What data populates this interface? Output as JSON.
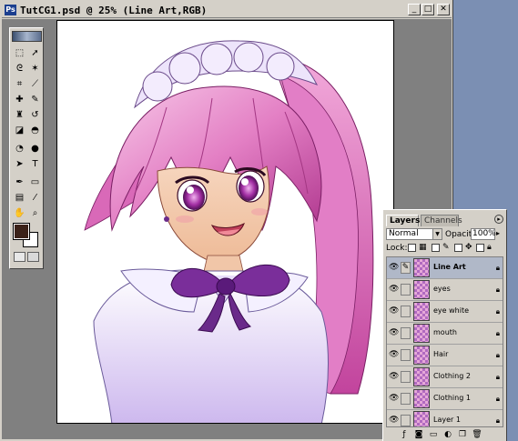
{
  "window": {
    "title": "TutCG1.psd @ 25% (Line Art,RGB)",
    "minimize_glyph": "_",
    "maximize_glyph": "□",
    "close_glyph": "✕"
  },
  "toolbox": {
    "foreground_color": "#3b2118",
    "background_color": "#ffffff",
    "tools": [
      {
        "name": "marquee-tool",
        "glyph": "⬚"
      },
      {
        "name": "move-tool",
        "glyph": "➚"
      },
      {
        "name": "lasso-tool",
        "glyph": "ᘓ"
      },
      {
        "name": "magic-wand-tool",
        "glyph": "✶"
      },
      {
        "name": "crop-tool",
        "glyph": "⌗"
      },
      {
        "name": "slice-tool",
        "glyph": "⟋"
      },
      {
        "name": "healing-brush-tool",
        "glyph": "✚"
      },
      {
        "name": "brush-tool",
        "glyph": "✎"
      },
      {
        "name": "clone-stamp-tool",
        "glyph": "♜"
      },
      {
        "name": "history-brush-tool",
        "glyph": "↺"
      },
      {
        "name": "eraser-tool",
        "glyph": "◪"
      },
      {
        "name": "bucket-tool",
        "glyph": "◓"
      },
      {
        "name": "blur-tool",
        "glyph": "◔"
      },
      {
        "name": "dodge-tool",
        "glyph": "●"
      },
      {
        "name": "path-select-tool",
        "glyph": "➤"
      },
      {
        "name": "type-tool",
        "glyph": "T"
      },
      {
        "name": "pen-tool",
        "glyph": "✒"
      },
      {
        "name": "shape-tool",
        "glyph": "▭"
      },
      {
        "name": "notes-tool",
        "glyph": "▤"
      },
      {
        "name": "eyedropper-tool",
        "glyph": "⁄"
      },
      {
        "name": "hand-tool",
        "glyph": "✋"
      },
      {
        "name": "zoom-tool",
        "glyph": "⌕"
      }
    ]
  },
  "layers_panel": {
    "tabs": [
      "Layers",
      "Channels"
    ],
    "blend_mode": "Normal",
    "opacity_label": "Opacity:",
    "opacity_value": "100%",
    "lock_label": "Lock:",
    "layers": [
      {
        "name": "Line Art",
        "selected": true,
        "visible": true
      },
      {
        "name": "eyes",
        "selected": false,
        "visible": true
      },
      {
        "name": "eye white",
        "selected": false,
        "visible": true
      },
      {
        "name": "mouth",
        "selected": false,
        "visible": true
      },
      {
        "name": "Hair",
        "selected": false,
        "visible": true
      },
      {
        "name": "Clothing 2",
        "selected": false,
        "visible": true
      },
      {
        "name": "Clothing 1",
        "selected": false,
        "visible": true
      },
      {
        "name": "Layer 1",
        "selected": false,
        "visible": true
      }
    ]
  },
  "colors": {
    "desktop": "#7b8fb3",
    "chrome": "#d4d0c8",
    "hair_pink": "#e37fc4",
    "eye_purple": "#8b2a8e",
    "bow_purple": "#6a2a8a"
  }
}
